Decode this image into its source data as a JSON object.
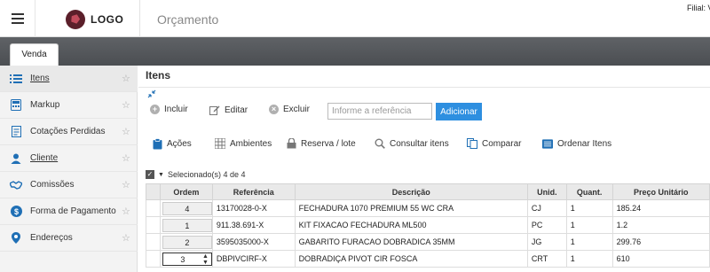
{
  "header": {
    "logo_text": "LOGO",
    "page_title": "Orçamento",
    "filial": "Filial: V"
  },
  "tabs": [
    {
      "label": "Venda"
    }
  ],
  "sidebar": {
    "items": [
      {
        "label": "Itens",
        "icon": "list-icon"
      },
      {
        "label": "Markup",
        "icon": "calculator-icon"
      },
      {
        "label": "Cotações Perdidas",
        "icon": "document-icon"
      },
      {
        "label": "Cliente",
        "icon": "user-icon"
      },
      {
        "label": "Comissões",
        "icon": "handshake-icon"
      },
      {
        "label": "Forma de Pagamento",
        "icon": "dollar-icon"
      },
      {
        "label": "Endereços",
        "icon": "map-pin-icon"
      }
    ]
  },
  "main": {
    "title": "Itens",
    "toolbar": {
      "incluir": "Incluir",
      "editar": "Editar",
      "excluir": "Excluir",
      "ref_placeholder": "Informe a referência",
      "adicionar": "Adicionar"
    },
    "actions": {
      "acoes": "Ações",
      "ambientes": "Ambientes",
      "reserva": "Reserva / lote",
      "consultar": "Consultar itens",
      "comparar": "Comparar",
      "ordenar": "Ordenar Itens"
    },
    "selection": "Selecionado(s) 4 de 4",
    "table": {
      "columns": [
        "Ordem",
        "Referência",
        "Descrição",
        "Unid.",
        "Quant.",
        "Preço Unitário"
      ],
      "rows": [
        {
          "ordem": "4",
          "referencia": "13170028-0-X",
          "descricao": "FECHADURA 1070 PREMIUM 55 WC CRA",
          "unid": "CJ",
          "quant": "1",
          "preco": "185.24"
        },
        {
          "ordem": "1",
          "referencia": "911.38.691-X",
          "descricao": "KIT FIXACAO FECHADURA ML500",
          "unid": "PC",
          "quant": "1",
          "preco": "1.2"
        },
        {
          "ordem": "2",
          "referencia": "3595035000-X",
          "descricao": "GABARITO FURACAO DOBRADICA 35MM",
          "unid": "JG",
          "quant": "1",
          "preco": "299.76"
        },
        {
          "ordem": "3",
          "referencia": "DBPIVCIRF-X",
          "descricao": "DOBRADIÇA PIVOT CIR FOSCA",
          "unid": "CRT",
          "quant": "1",
          "preco": "610"
        }
      ]
    }
  }
}
